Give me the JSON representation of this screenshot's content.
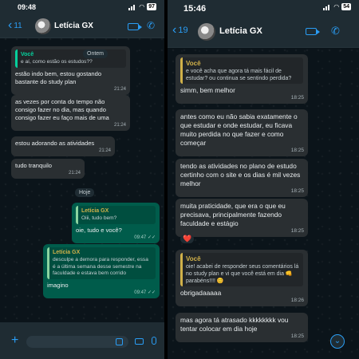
{
  "left": {
    "time": "09:48",
    "battery": "97",
    "back_count": "11",
    "contact": "Letícia GX",
    "date_chip_1": "Ontem",
    "date_chip_2": "Hoje",
    "messages": [
      {
        "quote_name": "Você",
        "quote_text": "e aí, como estão os estudos??",
        "text": "estão indo bem, estou gostando bastante do study plan",
        "time": "21:24"
      },
      {
        "text": "as vezes por conta do tempo não consigo fazer no dia, mas quando consigo fazer eu faço mais de uma",
        "time": "21:24"
      },
      {
        "text": "estou adorando as atividades",
        "time": "21:24"
      },
      {
        "text": "tudo tranquilo",
        "time": "21:24"
      },
      {
        "quote_name": "Letícia GX",
        "quote_text": "Oiii, tudo bem?",
        "text": "oie, tudo e você?",
        "time": "09:47"
      },
      {
        "quote_name": "Letícia GX",
        "quote_text": "desculpe a demora para responder, essa é a última semana desse semestre na faculdade e estava bem corrido",
        "text": "imagino",
        "time": "09:47"
      }
    ]
  },
  "right": {
    "time": "15:46",
    "battery": "54",
    "back_count": "19",
    "contact": "Letícia GX",
    "messages": [
      {
        "quote_name": "Você",
        "quote_text": "e você acha que agora tá mais fácil de estudar? ou continua se sentindo perdida?",
        "text": "simm, bem melhor",
        "time": "18:25"
      },
      {
        "text": "antes como eu não sabia exatamente o que estudar e onde estudar, eu ficava muito perdida no que fazer e como começar",
        "time": "18:25"
      },
      {
        "text": "tendo as atividades no plano de estudo certinho com o site e os dias é mil vezes melhor",
        "time": "18:25"
      },
      {
        "text": "muita praticidade, que era o que eu precisava, principalmente fazendo faculdade e estágio",
        "time": "18:25",
        "reaction": "❤️"
      },
      {
        "quote_name": "Você",
        "quote_text": "oie! acabei de responder seus comentários lá no study plan e vi que você está em dia 👊 parabéns!!!! 😊",
        "text": "obrigadaaaaa",
        "time": "18:26"
      },
      {
        "text": "mas agora tá atrasado kkkkkkkk vou tentar colocar em dia hoje",
        "time": "18:25"
      }
    ]
  },
  "icons": {
    "back": "chevron-left-icon",
    "video": "video-camera-icon",
    "phone": "phone-icon",
    "plus": "plus-icon",
    "sticker": "sticker-icon",
    "camera": "camera-icon",
    "mic": "microphone-icon",
    "scroll": "chevron-down-icon"
  }
}
